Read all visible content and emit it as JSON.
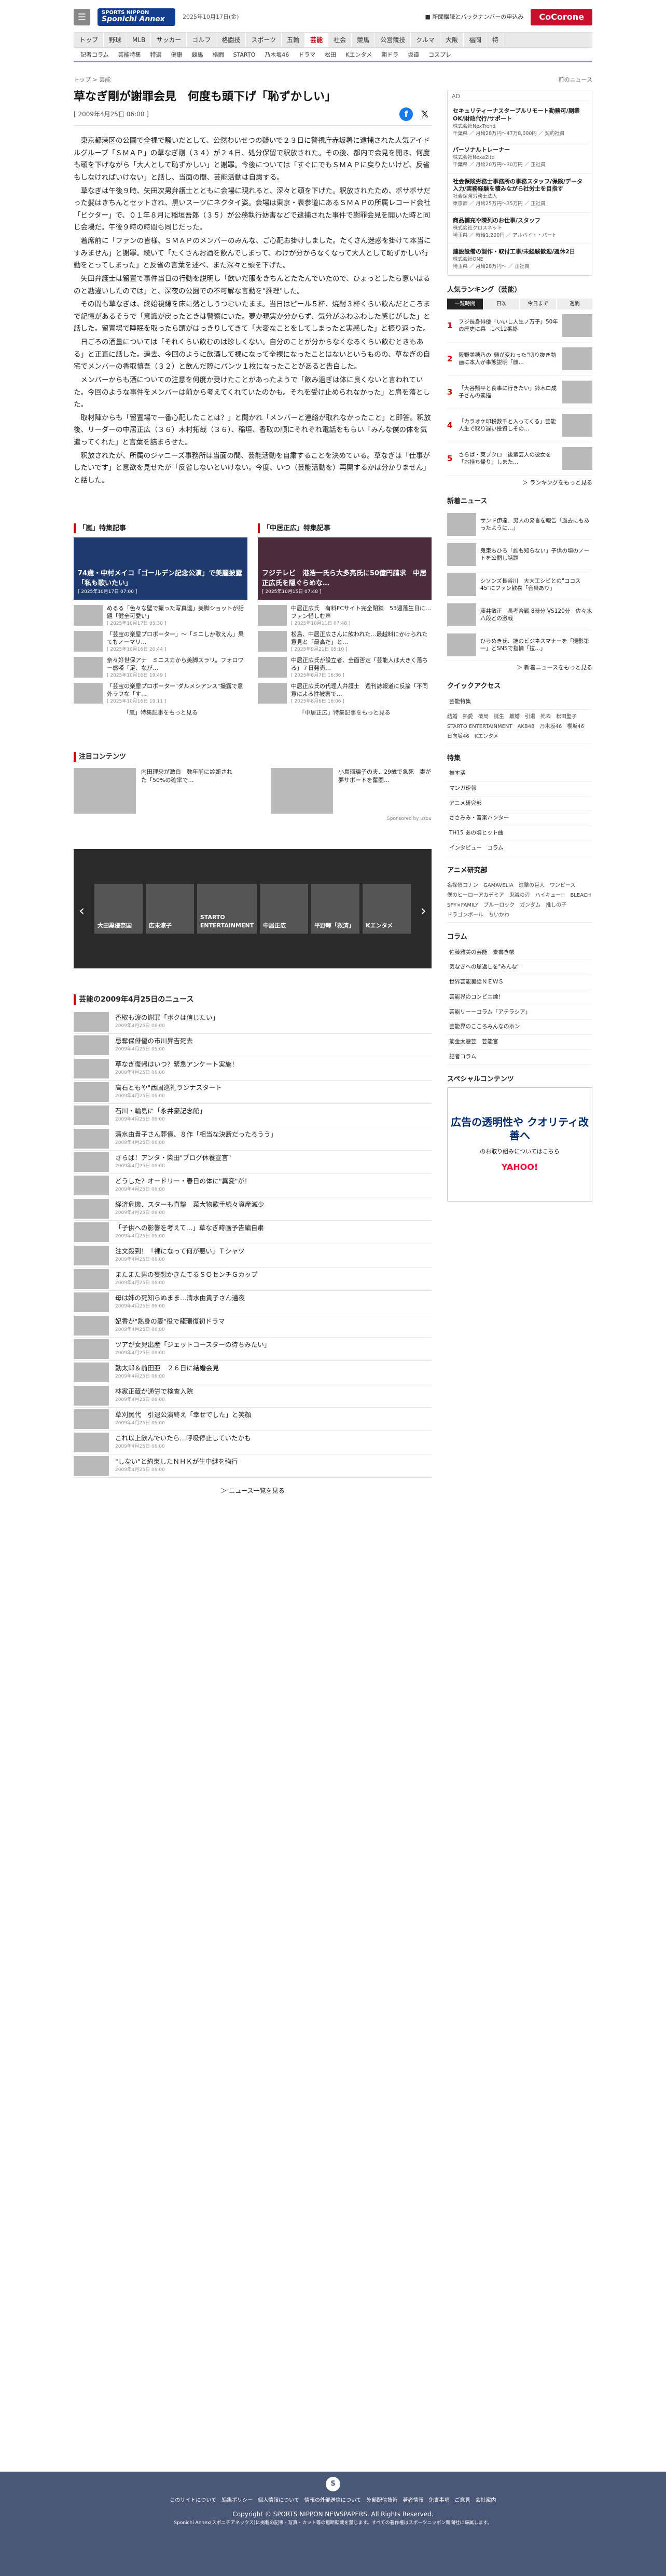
{
  "header": {
    "menu_icon": "☰",
    "logo_top": "SPORTS NIPPON",
    "logo_bottom": "Sponichi Annex",
    "date": "2025年10月17日(金)",
    "promo": "■ 新聞購読とバックナンバーの申込み",
    "cocorone": "CoCorone"
  },
  "nav1": [
    "トップ",
    "野球",
    "MLB",
    "サッカー",
    "ゴルフ",
    "格闘技",
    "スポーツ",
    "五輪",
    "芸能",
    "社会",
    "競馬",
    "公営競技",
    "クルマ",
    "大阪",
    "福岡",
    "特"
  ],
  "nav1_active": "芸能",
  "nav2": [
    "記者コラム",
    "芸能特集",
    "特選",
    "健康",
    "競馬",
    "格闘",
    "STARTO",
    "乃木坂46",
    "ドラマ",
    "松田",
    "Kエンタメ",
    "朝ドラ",
    "坂道",
    "コスプレ"
  ],
  "breadcrumb": {
    "top": "トップ",
    "sep": ">",
    "cat": "芸能",
    "prev": "前のニュース"
  },
  "article": {
    "title": "草なぎ剛が謝罪会見　何度も頭下げ「恥ずかしい」",
    "date": "[ 2009年4月25日 06:00 ]",
    "paras": [
      "東京都港区の公園で全裸で騒いだとして、公然わいせつの疑いで２３日に警視庁赤坂署に逮捕された人気アイドルグループ「ＳＭＡＰ」の草なぎ剛（３４）が２４日、処分保留で釈放された。その後、都内で会見を開き、何度も頭を下げながら「大人として恥ずかしい」と謝罪。今後については「すぐにでもＳＭＡＰに戻りたいけど、反省もしなければいけない」と話し、当面の間、芸能活動は自粛する。",
      "草なぎは午後９時、矢田次男弁護士とともに会場に現れると、深々と頭を下げた。釈放されたため、ボサボサだった髪はきちんとセットされ、黒いスーツにネクタイ姿。会場は東京・表参道にあるＳＭＡＰの所属レコード会社「ビクター」で、０１年８月に稲垣吾郎（３５）が公務執行妨害などで逮捕された事件で謝罪会見を開いた時と同じ会場だ。午後９時の時間も同じだった。",
      "着席前に「ファンの皆様、ＳＭＡＰのメンバーのみんな、ご心配お掛けしました。たくさん迷惑を掛けて本当にすみません」と謝罪。続いて「たくさんお酒を飲んでしまって、わけが分からなくなって大人として恥ずかしい行動をとってしまった」と反省の言葉を述べ、また深々と頭を下げた。",
      "矢田弁護士は留置で事件当日の行動を説明し「飲いだ服をきちんとたたんでいたので、ひょっとしたら意いはるのと勘違いしたのでは」と、深夜の公園での不可解な言動を\"推理\"した。",
      "その間も草なぎは、終始視線を床に落としうつむいたまま。当日はビール５杯、焼酎３杯くらい飲んだところまで記憶があるそうで「意識が戻ったときは警察にいた。夢か現実か分からず、気分がふわふわした感じがした」と話した。留置場で睡眠を取ったら頭がはっきりしてきて「大変なことをしてしまったと実感した」と振り返った。",
      "日ごろの酒量については「それくらい飲むのは珍しくない。自分のことが分からなくなるくらい飲むときもある」と正直に話した。過去、今回のように飲酒して裸になって全裸になったことはないというものの、草なぎの自宅でメンバーの香取慎吾（３２）と飲んだ際にパンツ１枚になったことがあると告白した。",
      "メンバーからも酒についての注意を何度か受けたことがあったようで「飲み過ぎは体に良くないと言われていた。今回のような事件をメンバーは前から考えてくれていたのかも。それを受け止められなかった」と肩を落とした。",
      "取材陣からも「留置場で一番心配したことは？」と聞かれ「メンバーと連絡が取れなかったこと」と即答。釈放後、リーダーの中居正広（３６）木村拓哉（３６）、稲垣、香取の順にそれぞれ電話をもらい「みんな僕の体を気遣ってくれた」と言葉を詰まらせた。",
      "釈放されたが、所属のジャニーズ事務所は当面の間、芸能活動を自粛することを決めている。草なぎは「仕事がしたいです」と意欲を見せたが「反省しないといけない。今度、いつ（芸能活動を）再開するかは分かりません」と話した。"
    ]
  },
  "features": [
    {
      "head": "「嵐」特集記事",
      "hero": "74歳・中村メイコ「ゴールデン記念公演」で美麗披露「私も歌いたい」",
      "hero_date": "[ 2025年10月17日 07:00 ]",
      "more": "「嵐」特集記事をもっと見る",
      "items": [
        {
          "t": "めるる「色々な壁で撮った写真達」美脚ショットが話題「健全可愛い」",
          "d": "[ 2025年10月17日 05:30 ]"
        },
        {
          "t": "「芸宝の楽屋プロポーター」〜「ミニしか歌えん」果てもノーマリ…",
          "d": "[ 2025年10月16日 20:44 ]"
        },
        {
          "t": "奈々好世保アナ　ミニスカから美脚スラリ。フォロワー感嘆「足、なが…",
          "d": "[ 2025年10月16日 19:49 ]"
        },
        {
          "t": "「芸宝の楽屋プロポーター\"ダルメシアンス\"撮露で意外ラフな「す…",
          "d": "[ 2025年10月16日 19:11 ]"
        }
      ]
    },
    {
      "head": "「中居正広」特集記事",
      "hero": "フジテレビ　港浩一氏ら大多亮氏に50億円請求　中居正広氏を隠ぐらめな…",
      "hero_date": "[ 2025年10月15日 07:48 ]",
      "more": "「中居正広」特集記事をもっと見る",
      "items": [
        {
          "t": "中居正広氏　有料FCサイト完全閉鎖　53週落生日に…ファン惜しむ声",
          "d": "[ 2025年10月11日 07:48 ]"
        },
        {
          "t": "松島、中居正広さんに飲われた…最越料にかけられた意見と「最高だ」と…",
          "d": "[ 2025年9月21日 05:10 ]"
        },
        {
          "t": "中居正広氏が設立者、全面否定「芸能人は大きく落ちる」７日発売…",
          "d": "[ 2025年8月7日 16:36 ]"
        },
        {
          "t": "中居正広氏の代理人弁護士　週刊誌報道に反論「不同意による性被害で…",
          "d": "[ 2025年8月6日 16:06 ]"
        }
      ]
    }
  ],
  "chui": {
    "head": "注目コンテンツ",
    "powered": "Sponsored by uzou",
    "items": [
      {
        "t": "内田理央が激白　数年前に診断された「50%の確率で…"
      },
      {
        "t": "小島瑠璃子の夫、29歳で急死　妻が夢サポートを奮闘…"
      }
    ]
  },
  "carousel": [
    "大田黒優奈国",
    "広末涼子",
    "STARTO ENTERTAINMENT",
    "中居正広",
    "平野暉「救済」",
    "Kエンタメ"
  ],
  "news": {
    "head": "芸能の2009年4月25日のニュース",
    "more": "＞ ニュース一覧を見る",
    "date": "2009年4月25日 06:00",
    "items": [
      "香取も涙の謝罪「ボクは信じたい」",
      "忌奪保俳優の市川昇吉死去",
      "草なぎ復帰はいつ？緊急アンケート実施！",
      "高石ともや\"西国巡礼ランナスタート",
      "石川・輪島に「永井豪記念館」",
      "清水由貴子さん葬儀、８作「相当な決断だったろうう」",
      "さらば！アンタ・柴田\"ブログ休養宣言\"",
      "どうした？オードリー・春日の体に\"異変\"が！",
      "経済危機、スターも直撃　菜大物歌手続々資産減少",
      "「子供への影響を考えて…」草なぎ時画予告編自粛",
      "注文殺到！「裸になって何が悪い」Ｔシャツ",
      "またまた男の妄想かきたてるＳＯセンチＧカップ",
      "母は姉の死知らぬまま…清水由貴子さん通夜",
      "妃香が\"熱身の妻\"役で龍珊復初ドラマ",
      "ツアが女児出産「ジェットコースターの待ちみたい」",
      "勤太郎＆前田亜　２６日に結婚会見",
      "林家正蔵が通労で検査入院",
      "草刈民代　引退公演終え「幸せでした」と笑顔",
      "これ以上飲んでいたら…呼吸停止していたかも",
      "\"しない\"と約束したＮＨＫが生中継を強行"
    ]
  },
  "right": {
    "job_head": "AD",
    "jobs": [
      {
        "c": "株式会社NexTrend",
        "n": "セキュリティーナスタープルリモート勤務可/副業OK/財政代行/サポート",
        "m": "千葉県 ／ 月給28万円〜47万8,000円 ／ 契約社員"
      },
      {
        "c": "株式会社Nexa2ltd",
        "n": "パーソナルトレーナー",
        "m": "千葉県 ／ 月給20万円〜30万円 ／ 正社員"
      },
      {
        "c": "社会保険労務士法人",
        "n": "社会保険労務士事務所の事務スタッフ/保険/データ入力/実務経験を積みながら社労士を目指す",
        "m": "東京都 ／ 月給25万円〜35万円 ／ 正社員"
      },
      {
        "c": "株式会社クロスネット",
        "n": "商品補充や陳列のお仕事/スタッフ",
        "m": "埼玉県 ／ 時給1,200円 ／ アルバイト・パート"
      },
      {
        "c": "株式会社ONE",
        "n": "建設設備の製作・取付工事/未経験歓迎/週休2日",
        "m": "埼玉県 ／ 月給28万円〜 ／ 正社員"
      }
    ],
    "ranking_head": "人気ランキング（芸能）",
    "tabs": [
      "一覧時間",
      "日次",
      "今日まで",
      "週間"
    ],
    "ranks": [
      {
        "no": "1",
        "t": "フジ長身俳優「いいし人生ノ万子」50年の歴史に幕　1ベ12番終"
      },
      {
        "no": "2",
        "t": "阪野美穂乃の\"顔が変わった\"切り抜き動画に本人が事態説明「顔…"
      },
      {
        "no": "3",
        "t": "「大谷翔平と食事に行きたい」鈴木ロ成子さんの素描"
      },
      {
        "no": "4",
        "t": "「カラオケ印税数千と入ってくる」芸能人生で取り遅い投資しその…"
      },
      {
        "no": "5",
        "t": "さらば・東ブクロ　後輩芸人の彼女を「お持ち帰り」しまた…"
      }
    ],
    "rank_more": "＞ ランキングをもっと見る",
    "new_head": "新着ニュース",
    "newitems": [
      {
        "t": "サンド伊達、男人の発言を報告「過去にもあったように…」"
      },
      {
        "t": "鬼束ちひろ「誰も知らない」子供の頃のノートを公開し話題"
      },
      {
        "t": "シソンズ長谷川　大大工シビとの\"ココス45\"にファン歓喜「音楽あり」"
      },
      {
        "t": "藤井敏正　長考合戦 8時分 VS120分　佐々木八段との激戦"
      },
      {
        "t": "ひらめき氏、謎のビジネスマナーを「撮影第一」とSNSで指摘「拉…」"
      }
    ],
    "new_more": "＞ 新着ニュースをもっと見る",
    "ql_head": "クイックアクセス",
    "ql": [
      "芸能特集"
    ],
    "tags": [
      "結婚",
      "熱愛",
      "破局",
      "誕生",
      "離婚",
      "引退",
      "死去",
      "松田聖子",
      "STARTO ENTERTAINMENT",
      "AKB48",
      "乃木坂46",
      "櫻坂46",
      "日向坂46",
      "Kエンタメ"
    ],
    "tok_head": "特集",
    "tok": [
      "推す活",
      "マンガ速報",
      "アニメ研究部",
      "ささみみ・音楽ハンター",
      "TH15 あの頃ヒット曲",
      "インタビュー　コラム"
    ],
    "anime_head": "アニメ研究部",
    "anime_tags": [
      "名探偵コナン",
      "GAMAVELIA",
      "進撃の巨人",
      "ワンピース",
      "僕のヒーローアカデミア",
      "鬼滅の刃",
      "ハイキュー!!",
      "BLEACH",
      "SPY×FAMILY",
      "ブルーロック",
      "ガンダム",
      "推しの子",
      "ドラゴンボール",
      "ちいかわ"
    ],
    "col_head": "コラム",
    "cols": [
      "佐藤雅美の芸能　素書き帳",
      "気なぎへの恩返しを\"みんな\"",
      "世界芸能裏話ＮＥＷＳ",
      "芸能界のコンビニ論！",
      "芸能リーーコラム「アテラシア」",
      "芸能界のこころみんなのホン",
      "筋金太遊芸　芸能官",
      "記者コラム"
    ],
    "sp_head": "スペシャルコンテンツ",
    "ad_big": "広告の透明性や クオリティ改善へ",
    "ad_small": "のお取り組みについてはこちら",
    "ad_brand": "YAHOO!"
  },
  "footer": {
    "links": [
      "このサイトについて",
      "編集ポリシー",
      "個人情報について",
      "情報の外部送信について",
      "外部配信技術",
      "著者情報",
      "免責事項",
      "ご意見",
      "会社案内"
    ],
    "copy": "Copyright © SPORTS NIPPON NEWSPAPERS. All Rights Reserved.",
    "copy2": "Sponichi Annex(スポニチアネックス)に掲載の記事・写真・カット等の無断転載を禁じます。すべての著作権はスポーツニッポン新聞社に帰属します。"
  }
}
